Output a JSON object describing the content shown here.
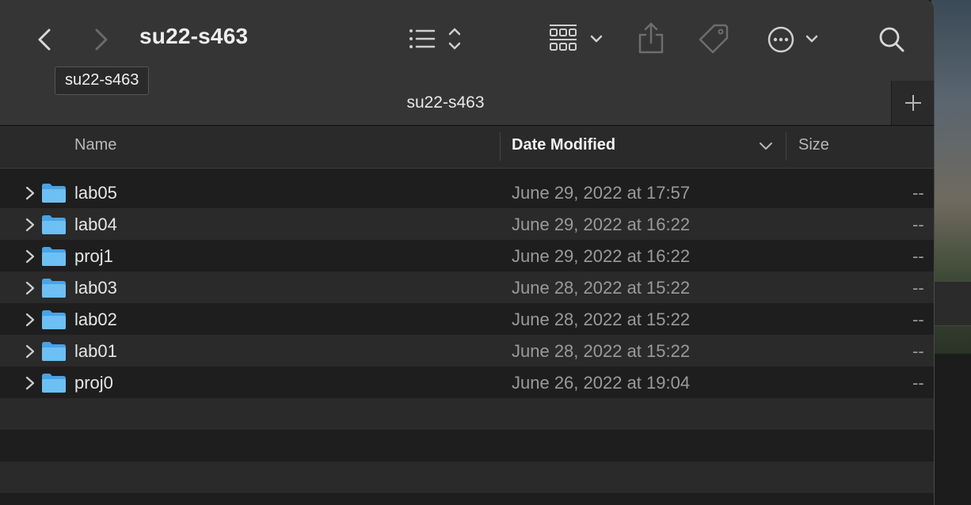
{
  "window": {
    "title": "su22-s463",
    "tab_title": "su22-s463",
    "tooltip": "su22-s463"
  },
  "toolbar": {
    "back_icon": "chevron-left-icon",
    "forward_icon": "chevron-right-icon",
    "view_icon": "list-view-icon",
    "group_icon": "grid-group-icon",
    "share_icon": "share-icon",
    "tag_icon": "tag-icon",
    "more_icon": "ellipsis-circle-icon",
    "search_icon": "search-icon",
    "new_tab_icon": "plus-icon"
  },
  "columns": {
    "name": "Name",
    "date": "Date Modified",
    "size": "Size"
  },
  "files": [
    {
      "name": "lab05",
      "date": "June 29, 2022 at 17:57",
      "size": "--"
    },
    {
      "name": "lab04",
      "date": "June 29, 2022 at 16:22",
      "size": "--"
    },
    {
      "name": "proj1",
      "date": "June 29, 2022 at 16:22",
      "size": "--"
    },
    {
      "name": "lab03",
      "date": "June 28, 2022 at 15:22",
      "size": "--"
    },
    {
      "name": "lab02",
      "date": "June 28, 2022 at 15:22",
      "size": "--"
    },
    {
      "name": "lab01",
      "date": "June 28, 2022 at 15:22",
      "size": "--"
    },
    {
      "name": "proj0",
      "date": "June 26, 2022 at 19:04",
      "size": "--"
    }
  ],
  "colors": {
    "toolbar_bg": "#353535",
    "row_alt": "#2a2a2a",
    "folder_blue": "#5fb4ee",
    "date_text": "#9a9a9a"
  }
}
